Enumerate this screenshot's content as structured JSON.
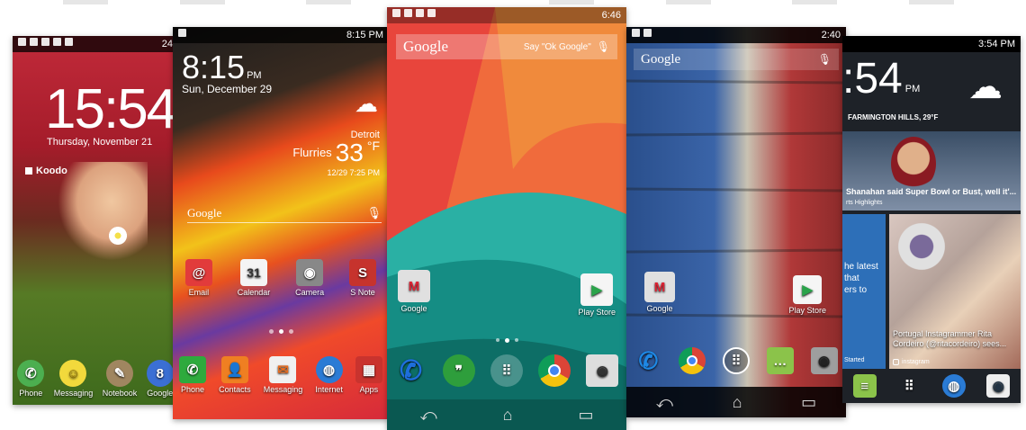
{
  "phones": {
    "lg": {
      "status_time": "24",
      "clock": "15:54",
      "date": "Thursday, November 21",
      "carrier": "Koodo",
      "dock": [
        "Phone",
        "Messaging",
        "Notebook",
        "Google"
      ]
    },
    "note3": {
      "status_time": "8:15 PM",
      "clock_time": "8:15",
      "clock_ampm": "PM",
      "date": "Sun, December 29",
      "weather_city": "Detroit",
      "weather_cond": "Flurries",
      "weather_temp": "33",
      "weather_unit": "°F",
      "updated": "12/29 7:25 PM",
      "search": "Google",
      "apps": [
        "Email",
        "Calendar",
        "Camera",
        "S Note"
      ],
      "calendar_day": "31",
      "dock": [
        "Phone",
        "Contacts",
        "Messaging",
        "Internet",
        "Apps"
      ]
    },
    "nexus5": {
      "status_time": "6:46",
      "search": "Google",
      "search_hint": "Say \"Ok Google\"",
      "apps": [
        "Google",
        "Play Store"
      ]
    },
    "motox": {
      "status_time": "2:40",
      "search": "Google",
      "apps": [
        "Google",
        "Play Store"
      ]
    },
    "htcone": {
      "status_time": "3:54 PM",
      "clock": ":54",
      "clock_ampm": "PM",
      "location": "FARMINGTON HILLS, 29°F",
      "news_headline": "Shanahan said Super Bowl or Bust, well it'...",
      "news_source": "rts Highlights",
      "side_text": "he latest\nthat\ners to",
      "side_footer": "Started",
      "photo_caption": "Portugal Instagrammer Rita Cordeiro (@ritacordeiro) sees...",
      "photo_source": "instagram"
    }
  },
  "colors": {
    "nexus_red": "#e8453c",
    "nexus_teal": "#1aa39a",
    "nexus_orange": "#f4a23b",
    "lg_green": "#5aa82e",
    "note3_yellow": "#f0c020"
  }
}
